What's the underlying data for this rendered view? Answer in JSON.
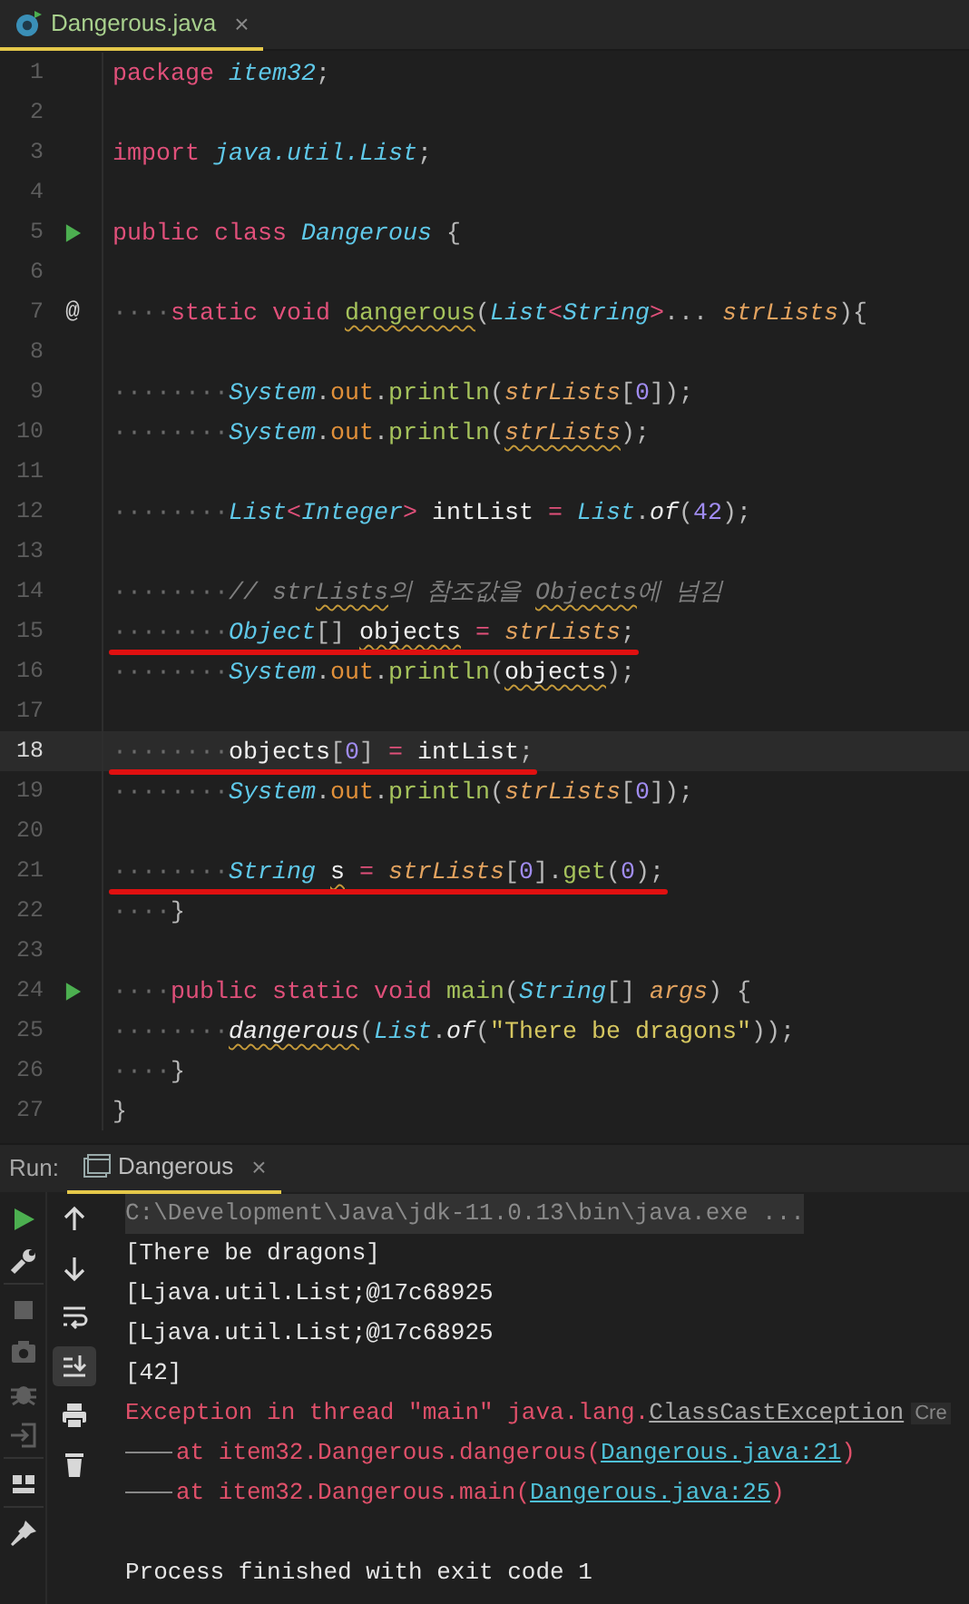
{
  "editor_tab": {
    "title": "Dangerous.java",
    "close": "×",
    "selected": true
  },
  "lines": [
    {
      "number": "1",
      "tokens": [
        {
          "text": "package ",
          "kind": "kw"
        },
        {
          "text": "item32",
          "kind": "type"
        },
        {
          "text": ";",
          "kind": "punct"
        }
      ]
    },
    {
      "number": "2"
    },
    {
      "number": "3",
      "tokens": [
        {
          "text": "import ",
          "kind": "kw"
        },
        {
          "text": "java.util.List",
          "kind": "type"
        },
        {
          "text": ";",
          "kind": "punct"
        }
      ]
    },
    {
      "number": "4"
    },
    {
      "number": "5",
      "gutter": {
        "kind": "run"
      },
      "tokens": [
        {
          "text": "public ",
          "kind": "kw"
        },
        {
          "text": "class ",
          "kind": "kw"
        },
        {
          "text": "Dangerous",
          "kind": "type"
        },
        {
          "text": " {",
          "kind": "punct"
        }
      ]
    },
    {
      "number": "6"
    },
    {
      "number": "7",
      "gutter": {
        "kind": "mark",
        "text": "@"
      },
      "tokens": [
        {
          "text": "····",
          "kind": "ws"
        },
        {
          "text": "static ",
          "kind": "kw"
        },
        {
          "text": "void ",
          "kind": "kw"
        },
        {
          "text": "dangerous",
          "kind": "method",
          "warning": true
        },
        {
          "text": "(",
          "kind": "punct"
        },
        {
          "text": "List",
          "kind": "type"
        },
        {
          "text": "<",
          "kind": "op"
        },
        {
          "text": "String",
          "kind": "type"
        },
        {
          "text": ">",
          "kind": "op"
        },
        {
          "text": "... ",
          "kind": "punct"
        },
        {
          "text": "strLists",
          "kind": "param"
        },
        {
          "text": "){",
          "kind": "punct"
        }
      ]
    },
    {
      "number": "8"
    },
    {
      "number": "9",
      "tokens": [
        {
          "text": "········",
          "kind": "ws"
        },
        {
          "text": "System",
          "kind": "type"
        },
        {
          "text": ".",
          "kind": "punct"
        },
        {
          "text": "out",
          "kind": "field"
        },
        {
          "text": ".",
          "kind": "punct"
        },
        {
          "text": "println",
          "kind": "method"
        },
        {
          "text": "(",
          "kind": "punct"
        },
        {
          "text": "strLists",
          "kind": "param"
        },
        {
          "text": "[",
          "kind": "punct"
        },
        {
          "text": "0",
          "kind": "num"
        },
        {
          "text": "]);",
          "kind": "punct"
        }
      ]
    },
    {
      "number": "10",
      "tokens": [
        {
          "text": "········",
          "kind": "ws"
        },
        {
          "text": "System",
          "kind": "type"
        },
        {
          "text": ".",
          "kind": "punct"
        },
        {
          "text": "out",
          "kind": "field"
        },
        {
          "text": ".",
          "kind": "punct"
        },
        {
          "text": "println",
          "kind": "method"
        },
        {
          "text": "(",
          "kind": "punct"
        },
        {
          "text": "strLists",
          "kind": "param",
          "warning": true
        },
        {
          "text": ");",
          "kind": "punct"
        }
      ]
    },
    {
      "number": "11"
    },
    {
      "number": "12",
      "tokens": [
        {
          "text": "········",
          "kind": "ws"
        },
        {
          "text": "List",
          "kind": "type"
        },
        {
          "text": "<",
          "kind": "op"
        },
        {
          "text": "Integer",
          "kind": "type"
        },
        {
          "text": "> ",
          "kind": "op"
        },
        {
          "text": "intList",
          "kind": "var"
        },
        {
          "text": " = ",
          "kind": "op"
        },
        {
          "text": "List",
          "kind": "type"
        },
        {
          "text": ".",
          "kind": "punct"
        },
        {
          "text": "of",
          "kind": "call"
        },
        {
          "text": "(",
          "kind": "punct"
        },
        {
          "text": "42",
          "kind": "num"
        },
        {
          "text": ");",
          "kind": "punct"
        }
      ]
    },
    {
      "number": "13"
    },
    {
      "number": "14",
      "tokens": [
        {
          "text": "········",
          "kind": "ws"
        },
        {
          "text": "// str",
          "kind": "cmt"
        },
        {
          "text": "Lists",
          "kind": "cmt",
          "warning": true
        },
        {
          "text": "의 참조값을 ",
          "kind": "cmt"
        },
        {
          "text": "Objects",
          "kind": "cmt",
          "warning": true
        },
        {
          "text": "에 넘김",
          "kind": "cmt"
        }
      ]
    },
    {
      "number": "15",
      "underlined": true,
      "tokens": [
        {
          "text": "········",
          "kind": "ws"
        },
        {
          "text": "Object",
          "kind": "type"
        },
        {
          "text": "[] ",
          "kind": "punct"
        },
        {
          "text": "objects",
          "kind": "var",
          "warning": true
        },
        {
          "text": " = ",
          "kind": "op"
        },
        {
          "text": "strLists",
          "kind": "param"
        },
        {
          "text": ";",
          "kind": "punct"
        }
      ]
    },
    {
      "number": "16",
      "tokens": [
        {
          "text": "········",
          "kind": "ws"
        },
        {
          "text": "System",
          "kind": "type"
        },
        {
          "text": ".",
          "kind": "punct"
        },
        {
          "text": "out",
          "kind": "field"
        },
        {
          "text": ".",
          "kind": "punct"
        },
        {
          "text": "println",
          "kind": "method"
        },
        {
          "text": "(",
          "kind": "punct"
        },
        {
          "text": "objects",
          "kind": "var",
          "warning": true
        },
        {
          "text": ");",
          "kind": "punct"
        }
      ]
    },
    {
      "number": "17"
    },
    {
      "number": "18",
      "current": true,
      "underlined": true,
      "tokens": [
        {
          "text": "········",
          "kind": "ws"
        },
        {
          "text": "objects",
          "kind": "var"
        },
        {
          "text": "[",
          "kind": "punct"
        },
        {
          "text": "0",
          "kind": "num"
        },
        {
          "text": "]",
          "kind": "punct"
        },
        {
          "text": " = ",
          "kind": "op"
        },
        {
          "text": "intList",
          "kind": "var"
        },
        {
          "text": ";",
          "kind": "punct"
        }
      ]
    },
    {
      "number": "19",
      "tokens": [
        {
          "text": "········",
          "kind": "ws"
        },
        {
          "text": "System",
          "kind": "type"
        },
        {
          "text": ".",
          "kind": "punct"
        },
        {
          "text": "out",
          "kind": "field"
        },
        {
          "text": ".",
          "kind": "punct"
        },
        {
          "text": "println",
          "kind": "method"
        },
        {
          "text": "(",
          "kind": "punct"
        },
        {
          "text": "strLists",
          "kind": "param"
        },
        {
          "text": "[",
          "kind": "punct"
        },
        {
          "text": "0",
          "kind": "num"
        },
        {
          "text": "]);",
          "kind": "punct"
        }
      ]
    },
    {
      "number": "20"
    },
    {
      "number": "21",
      "underlined": true,
      "tokens": [
        {
          "text": "········",
          "kind": "ws"
        },
        {
          "text": "String ",
          "kind": "type"
        },
        {
          "text": "s",
          "kind": "var",
          "warning": true
        },
        {
          "text": " = ",
          "kind": "op"
        },
        {
          "text": "strLists",
          "kind": "param"
        },
        {
          "text": "[",
          "kind": "punct"
        },
        {
          "text": "0",
          "kind": "num"
        },
        {
          "text": "].",
          "kind": "punct"
        },
        {
          "text": "get",
          "kind": "method"
        },
        {
          "text": "(",
          "kind": "punct"
        },
        {
          "text": "0",
          "kind": "num"
        },
        {
          "text": ");",
          "kind": "punct"
        }
      ]
    },
    {
      "number": "22",
      "tokens": [
        {
          "text": "····",
          "kind": "ws"
        },
        {
          "text": "}",
          "kind": "punct"
        }
      ]
    },
    {
      "number": "23"
    },
    {
      "number": "24",
      "gutter": {
        "kind": "run"
      },
      "tokens": [
        {
          "text": "····",
          "kind": "ws"
        },
        {
          "text": "public ",
          "kind": "kw"
        },
        {
          "text": "static ",
          "kind": "kw"
        },
        {
          "text": "void ",
          "kind": "kw"
        },
        {
          "text": "main",
          "kind": "method"
        },
        {
          "text": "(",
          "kind": "punct"
        },
        {
          "text": "String",
          "kind": "type"
        },
        {
          "text": "[] ",
          "kind": "punct"
        },
        {
          "text": "args",
          "kind": "param"
        },
        {
          "text": ") {",
          "kind": "punct"
        }
      ]
    },
    {
      "number": "25",
      "tokens": [
        {
          "text": "········",
          "kind": "ws"
        },
        {
          "text": "dangerous",
          "kind": "call",
          "warning": true
        },
        {
          "text": "(",
          "kind": "punct"
        },
        {
          "text": "List",
          "kind": "type"
        },
        {
          "text": ".",
          "kind": "punct"
        },
        {
          "text": "of",
          "kind": "call"
        },
        {
          "text": "(",
          "kind": "punct"
        },
        {
          "text": "\"There be dragons\"",
          "kind": "str"
        },
        {
          "text": "));",
          "kind": "punct"
        }
      ]
    },
    {
      "number": "26",
      "tokens": [
        {
          "text": "····",
          "kind": "ws"
        },
        {
          "text": "}",
          "kind": "punct"
        }
      ]
    },
    {
      "number": "27",
      "tokens": [
        {
          "text": "}",
          "kind": "punct"
        }
      ]
    }
  ],
  "run_panel": {
    "label": "Run:",
    "tab": {
      "title": "Dangerous",
      "close": "×",
      "selected": true
    },
    "side_tools": [
      {
        "kind": "run",
        "disabled": false
      },
      {
        "kind": "wrench",
        "disabled": false
      },
      {
        "kind": "stop",
        "disabled": true
      },
      {
        "kind": "camera",
        "disabled": true
      },
      {
        "kind": "bug",
        "disabled": true
      },
      {
        "kind": "enter",
        "disabled": true
      },
      {
        "kind": "layout",
        "disabled": false
      },
      {
        "kind": "pin",
        "disabled": false
      }
    ],
    "console_tools": [
      {
        "kind": "up",
        "selected": false
      },
      {
        "kind": "down",
        "selected": false
      },
      {
        "kind": "wrap",
        "selected": false
      },
      {
        "kind": "scroll-end",
        "selected": true
      },
      {
        "kind": "print",
        "selected": false
      },
      {
        "kind": "trash",
        "selected": false
      }
    ],
    "console": [
      {
        "kind": "command",
        "parts": [
          {
            "text": "C:\\Development\\Java\\jdk-11.0.13\\bin\\java.exe ...",
            "kind": "plain"
          }
        ]
      },
      {
        "kind": "out",
        "parts": [
          {
            "text": "[There be dragons]",
            "kind": "plain"
          }
        ]
      },
      {
        "kind": "out",
        "parts": [
          {
            "text": "[Ljava.util.List;@17c68925",
            "kind": "plain"
          }
        ]
      },
      {
        "kind": "out",
        "parts": [
          {
            "text": "[Ljava.util.List;@17c68925",
            "kind": "plain"
          }
        ]
      },
      {
        "kind": "out",
        "parts": [
          {
            "text": "[42]",
            "kind": "plain"
          }
        ]
      },
      {
        "kind": "error",
        "parts": [
          {
            "text": "Exception in thread \"main\" java.lang.",
            "kind": "plain"
          },
          {
            "text": "ClassCastException",
            "kind": "class-link"
          },
          {
            "text": "Cre",
            "kind": "hint"
          }
        ]
      },
      {
        "kind": "stack",
        "parts": [
          {
            "text": "at item32.Dangerous.dangerous(",
            "kind": "plain"
          },
          {
            "text": "Dangerous.java:21",
            "kind": "link"
          },
          {
            "text": ")",
            "kind": "plain"
          }
        ]
      },
      {
        "kind": "stack",
        "parts": [
          {
            "text": "at item32.Dangerous.main(",
            "kind": "plain"
          },
          {
            "text": "Dangerous.java:25",
            "kind": "link"
          },
          {
            "text": ")",
            "kind": "plain"
          }
        ]
      },
      {
        "kind": "blank"
      },
      {
        "kind": "out",
        "parts": [
          {
            "text": "Process finished with exit code 1",
            "kind": "plain"
          }
        ]
      }
    ]
  }
}
